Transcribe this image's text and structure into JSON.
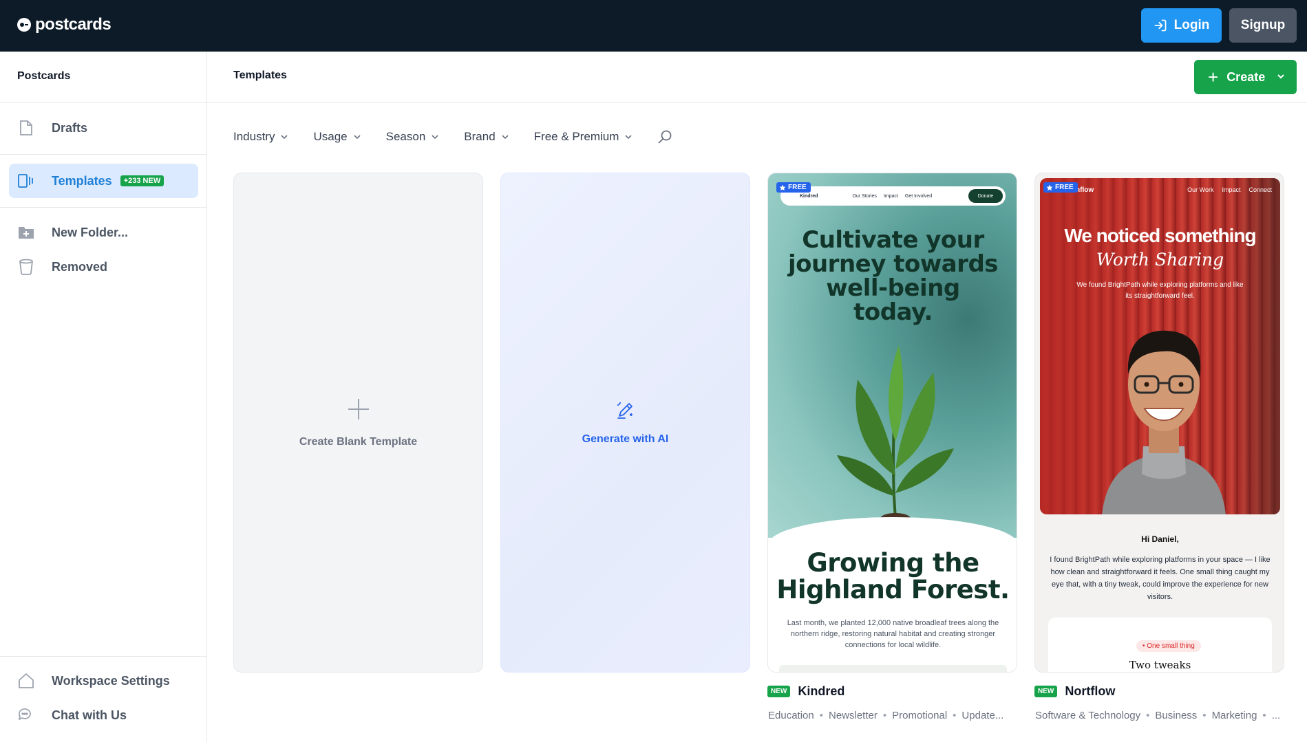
{
  "app": {
    "logo_text": "postcards"
  },
  "topbar": {
    "login_label": "Login",
    "signup_label": "Signup"
  },
  "sidebar": {
    "title": "Postcards",
    "items": [
      {
        "label": "Drafts",
        "icon": "document-icon"
      },
      {
        "label": "Templates",
        "icon": "templates-icon",
        "badge": "+233 NEW",
        "active": true
      },
      {
        "label": "New Folder...",
        "icon": "folder-plus-icon"
      },
      {
        "label": "Removed",
        "icon": "trash-icon"
      }
    ],
    "footer": [
      {
        "label": "Workspace Settings",
        "icon": "home-icon"
      },
      {
        "label": "Chat with Us",
        "icon": "chat-icon"
      }
    ]
  },
  "main": {
    "title": "Templates",
    "create_label": "Create",
    "filters": [
      "Industry",
      "Usage",
      "Season",
      "Brand",
      "Free & Premium"
    ],
    "blank_label": "Create Blank Template",
    "ai_label": "Generate with AI"
  },
  "templates": [
    {
      "badge_free": "FREE",
      "badge_new": "NEW",
      "name": "Kindred",
      "tags": [
        "Education",
        "Newsletter",
        "Promotional",
        "Update..."
      ],
      "preview": {
        "brand": "Kindred",
        "nav": [
          "Our Stories",
          "Impact",
          "Get Involved"
        ],
        "cta": "Donate",
        "headline": [
          "Cultivate your",
          "journey towards",
          "well-being",
          "today."
        ],
        "title": [
          "Growing the",
          "Highland Forest."
        ],
        "body": "Last month, we planted 12,000 native broadleaf trees along the northern ridge, restoring natural habitat and creating stronger connections for local wildlife."
      }
    },
    {
      "badge_free": "FREE",
      "badge_new": "NEW",
      "name": "Nortflow",
      "tags": [
        "Software & Technology",
        "Business",
        "Marketing",
        "..."
      ],
      "preview": {
        "brand": "nflow",
        "nav": [
          "Our Work",
          "Impact",
          "Connect"
        ],
        "headline": "We noticed something",
        "subheadline": "Worth Sharing",
        "sub": "We found BrightPath while exploring platforms and like its straightforward feel.",
        "greeting": "Hi Daniel,",
        "body": "I found BrightPath while exploring platforms in your space — I like how clean and straightforward it feels. One small thing caught my eye that, with a tiny tweak, could improve the experience for new visitors.",
        "pill": "• One small thing",
        "cut": "Two tweaks"
      }
    }
  ],
  "colors": {
    "topbar": "#0c1b27",
    "login": "#2196f3",
    "signup": "#4b5563",
    "create": "#16a34a",
    "active_nav": "#dbeafe",
    "accent": "#1e7fd6"
  }
}
